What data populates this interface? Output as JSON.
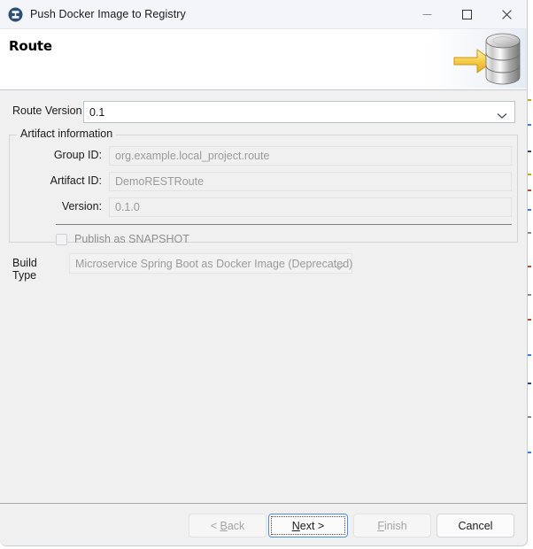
{
  "window": {
    "title": "Push Docker Image to Registry",
    "app_icon": "docker-registry-icon",
    "controls": {
      "minimize": "minimize-icon",
      "maximize": "maximize-icon",
      "close": "close-icon"
    }
  },
  "header": {
    "title": "Route",
    "banner_icon": "database-push-icon"
  },
  "form": {
    "route_version": {
      "label": "Route Version",
      "value": "0.1",
      "arrow": "chevron-down-icon"
    },
    "artifact_group": {
      "legend": "Artifact information",
      "fields": [
        {
          "label": "Group ID:",
          "value": "org.example.local_project.route",
          "disabled": true
        },
        {
          "label": "Artifact ID:",
          "value": "DemoRESTRoute",
          "disabled": true
        },
        {
          "label": "Version:",
          "value": "0.1.0",
          "disabled": true
        }
      ],
      "snapshot": {
        "label": "Publish as SNAPSHOT",
        "checked": false,
        "disabled": true
      }
    },
    "build_type": {
      "label": "Build Type",
      "value": "Microservice Spring Boot as Docker Image (Deprecated)",
      "disabled": true,
      "arrow": "chevron-down-icon"
    }
  },
  "buttons": {
    "back": {
      "label": "< Back",
      "mnemonic": "B",
      "disabled": true,
      "focused": false
    },
    "next": {
      "label": "Next >",
      "mnemonic": "N",
      "disabled": false,
      "focused": true
    },
    "finish": {
      "label": "Finish",
      "mnemonic": "F",
      "disabled": true,
      "focused": false
    },
    "cancel": {
      "label": "Cancel",
      "mnemonic": "",
      "disabled": false,
      "focused": false
    }
  },
  "colors": {
    "dialog_bg": "#f0f0f0",
    "titlebar_bg": "#f3f5f9",
    "header_bg": "#ffffff",
    "accent_focus": "#4a90d9",
    "disabled_text": "#9a9a9a",
    "app_icon_blue": "#2d4f76",
    "banner_arrow_gold": "#f5c443"
  }
}
